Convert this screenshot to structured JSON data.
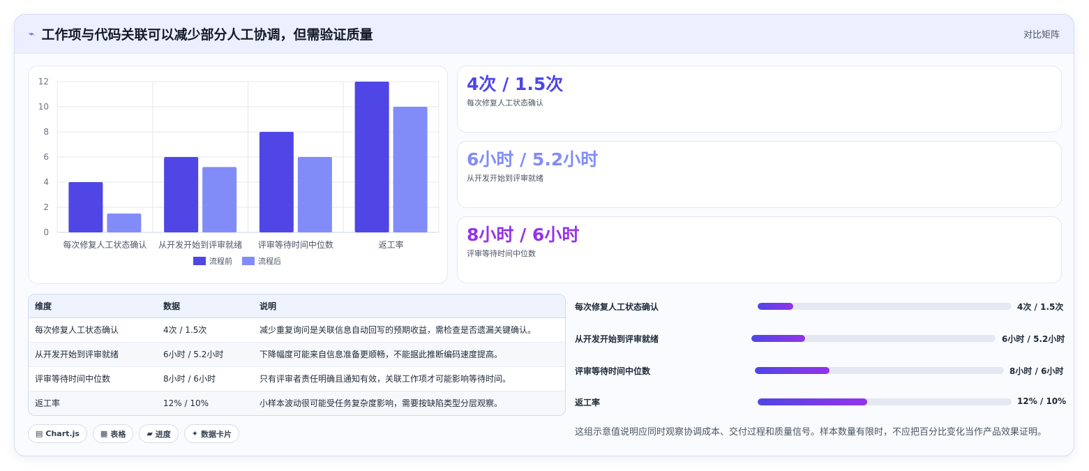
{
  "header": {
    "icon": "bolt-icon",
    "title": "工作项与代码关联可以减少部分人工协调，但需验证质量",
    "tag": "对比矩阵"
  },
  "colors": {
    "before": "#4f46e5",
    "after": "#818cf8",
    "stat1": "#4f46e5",
    "stat2": "#818cf8",
    "stat3": "#9333ea"
  },
  "chart_data": {
    "type": "bar",
    "categories": [
      "每次修复人工状态确认",
      "从开发开始到评审就绪",
      "评审等待时间中位数",
      "返工率"
    ],
    "series": [
      {
        "name": "流程前",
        "values": [
          4,
          6,
          8,
          12
        ]
      },
      {
        "name": "流程后",
        "values": [
          1.5,
          5.2,
          6,
          10
        ]
      }
    ],
    "ylim": [
      0,
      12
    ],
    "yticks": [
      "0",
      "2",
      "4",
      "6",
      "8",
      "10",
      "12"
    ],
    "legend": "bottom",
    "grid": true
  },
  "stats": [
    {
      "value": "4次 / 1.5次",
      "label": "每次修复人工状态确认"
    },
    {
      "value": "6小时 / 5.2小时",
      "label": "从开发开始到评审就绪"
    },
    {
      "value": "8小时 / 6小时",
      "label": "评审等待时间中位数"
    }
  ],
  "table": {
    "headers": [
      "维度",
      "数据",
      "说明"
    ],
    "rows": [
      [
        "每次修复人工状态确认",
        "4次 / 1.5次",
        "减少重复询问是关联信息自动回写的预期收益，需检查是否遗漏关键确认。"
      ],
      [
        "从开发开始到评审就绪",
        "6小时 / 5.2小时",
        "下降幅度可能来自信息准备更顺畅，不能据此推断编码速度提高。"
      ],
      [
        "评审等待时间中位数",
        "8小时 / 6小时",
        "只有评审者责任明确且通知有效，关联工作项才可能影响等待时间。"
      ],
      [
        "返工率",
        "12% / 10%",
        "小样本波动很可能受任务复杂度影响，需要按缺陷类型分层观察。"
      ]
    ]
  },
  "chips": [
    {
      "icon": "chart-icon",
      "glyph": "▤",
      "label": "Chart.js"
    },
    {
      "icon": "table-icon",
      "glyph": "▦",
      "label": "表格"
    },
    {
      "icon": "progress-icon",
      "glyph": "▰",
      "label": "进度"
    },
    {
      "icon": "sparkle-icon",
      "glyph": "✦",
      "label": "数据卡片"
    }
  ],
  "progress": [
    {
      "label": "每次修复人工状态确认",
      "value": "4次 / 1.5次",
      "fill": 0.14
    },
    {
      "label": "从开发开始到评审就绪",
      "value": "6小时 / 5.2小时",
      "fill": 0.22
    },
    {
      "label": "评审等待时间中位数",
      "value": "8小时 / 6小时",
      "fill": 0.3
    },
    {
      "label": "返工率",
      "value": "12% / 10%",
      "fill": 0.43
    }
  ],
  "footnote": "这组示意值说明应同时观察协调成本、交付过程和质量信号。样本数量有限时，不应把百分比变化当作产品效果证明。"
}
